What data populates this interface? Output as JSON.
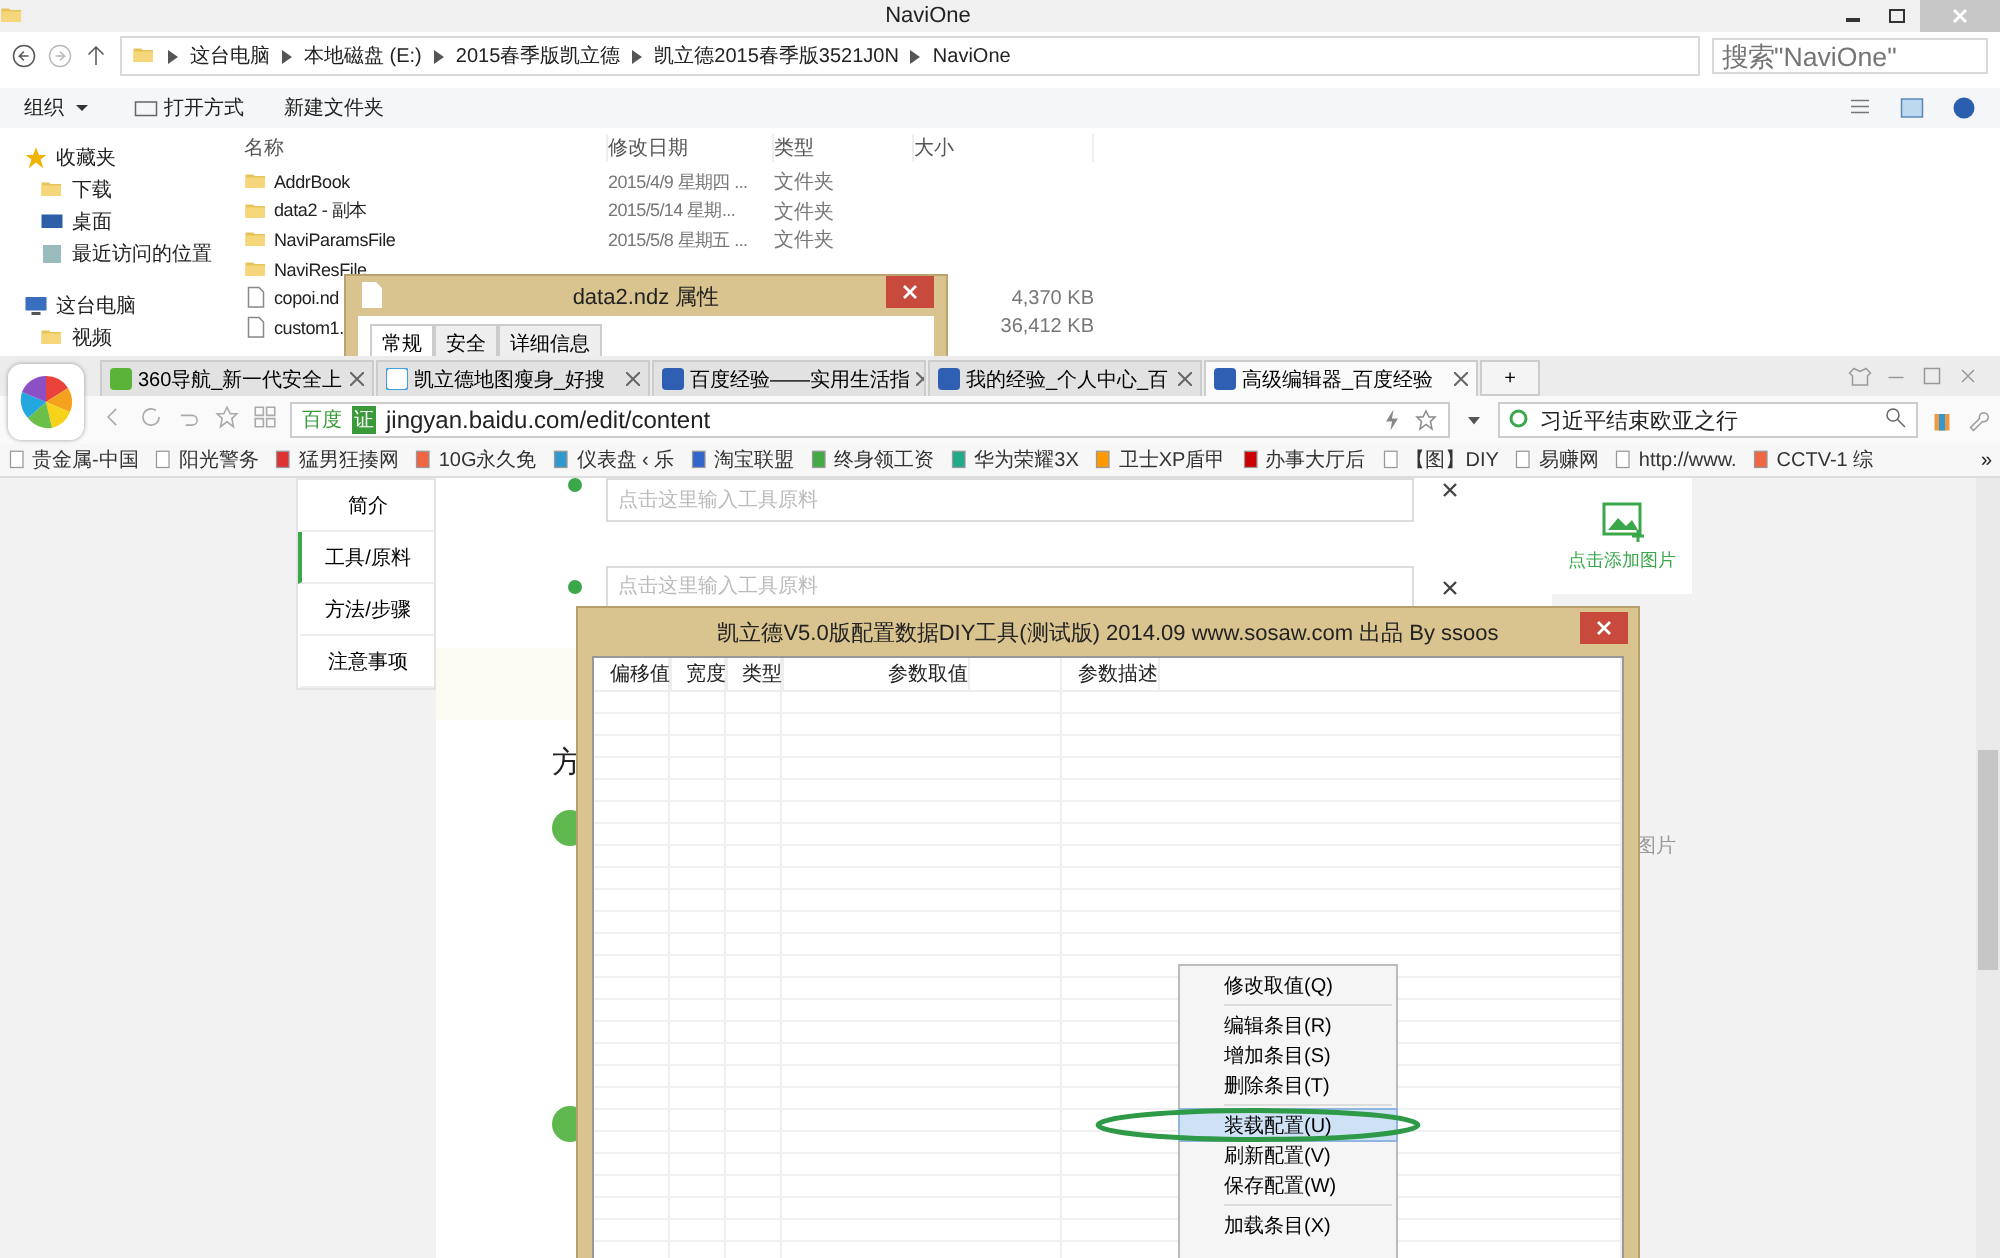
{
  "explorer": {
    "title": "NaviOne",
    "breadcrumb": [
      "这台电脑",
      "本地磁盘 (E:)",
      "2015春季版凯立德",
      "凯立德2015春季版3521J0N",
      "NaviOne"
    ],
    "search_placeholder": "搜索\"NaviOne\"",
    "toolbar": [
      {
        "label": "组织",
        "kind": "menu"
      },
      {
        "label": "打开方式",
        "kind": "open"
      },
      {
        "label": "新建文件夹",
        "kind": "plain"
      }
    ],
    "nav": [
      {
        "label": "收藏夹",
        "kind": "star"
      },
      {
        "label": "下载",
        "kind": "download"
      },
      {
        "label": "桌面",
        "kind": "desktop"
      },
      {
        "label": "最近访问的位置",
        "kind": "recent"
      },
      {
        "label": "这台电脑",
        "kind": "computer"
      },
      {
        "label": "视频",
        "kind": "video"
      }
    ],
    "columns": [
      "名称",
      "修改日期",
      "类型",
      "大小"
    ],
    "files": [
      {
        "name": "AddrBook",
        "kind": "folder",
        "date": "2015/4/9 星期四 ...",
        "type": "文件夹"
      },
      {
        "name": "data2 - 副本",
        "kind": "folder",
        "date": "2015/5/14 星期...",
        "type": "文件夹"
      },
      {
        "name": "NaviParamsFile",
        "kind": "folder",
        "date": "2015/5/8 星期五 ...",
        "type": "文件夹"
      },
      {
        "name": "NaviResFile",
        "kind": "folder"
      },
      {
        "name": "copoi.nd",
        "kind": "file",
        "size": "4,370 KB"
      },
      {
        "name": "custom1.",
        "kind": "file",
        "size": "36,412 KB"
      }
    ]
  },
  "properties": {
    "title": "data2.ndz 属性",
    "tabs": [
      {
        "label": "常规",
        "selected": true
      },
      {
        "label": "安全",
        "selected": false
      },
      {
        "label": "详细信息",
        "selected": false
      }
    ]
  },
  "browser": {
    "tabs": [
      {
        "label": "360导航_新一代安全上",
        "selected": false
      },
      {
        "label": "凯立德地图瘦身_好搜",
        "selected": false
      },
      {
        "label": "百度经验——实用生活指",
        "selected": false
      },
      {
        "label": "我的经验_个人中心_百",
        "selected": false
      },
      {
        "label": "高级编辑器_百度经验",
        "selected": true
      }
    ],
    "new_tab": "+",
    "site_badge": "百度",
    "cert_badge": "证",
    "url": "jingyan.baidu.com/edit/content",
    "search": "习近平结束欧亚之行",
    "bookmarks": [
      "贵金属-中国",
      "阳光警务",
      "猛男狂揍网",
      "10G永久免",
      "仪表盘 ‹ 乐",
      "淘宝联盟",
      "终身领工资",
      "华为荣耀3X",
      "卫士XP盾甲",
      "办事大厅后",
      "【图】DIY",
      "易赚网",
      "http://www.",
      "CCTV-1 综"
    ],
    "more": "»",
    "page": {
      "nav": [
        {
          "label": "简介",
          "selected": false
        },
        {
          "label": "工具/原料",
          "selected": true
        },
        {
          "label": "方法/步骤",
          "selected": false
        },
        {
          "label": "注意事项",
          "selected": false
        }
      ],
      "inputs": [
        {
          "placeholder": "点击这里输入工具原料"
        },
        {
          "placeholder": "点击这里输入工具原料"
        }
      ],
      "add_image": "点击添加图片",
      "heading": "方",
      "side_text": "图片"
    }
  },
  "dialog": {
    "title": "凯立德V5.0版配置数据DIY工具(测试版) 2014.09  www.sosaw.com 出品 By ssoos",
    "columns": [
      "偏移值",
      "宽度",
      "类型",
      "参数取值",
      "参数描述"
    ],
    "menu": [
      {
        "kind": "item",
        "label": "修改取值(Q)",
        "selected": false
      },
      {
        "kind": "separator"
      },
      {
        "kind": "item",
        "label": "编辑条目(R)",
        "selected": false
      },
      {
        "kind": "item",
        "label": "增加条目(S)",
        "selected": false
      },
      {
        "kind": "item",
        "label": "删除条目(T)",
        "selected": false
      },
      {
        "kind": "separator"
      },
      {
        "kind": "item",
        "label": "装载配置(U)",
        "selected": true
      },
      {
        "kind": "item",
        "label": "刷新配置(V)",
        "selected": false
      },
      {
        "kind": "item",
        "label": "保存配置(W)",
        "selected": false
      },
      {
        "kind": "separator"
      },
      {
        "kind": "item",
        "label": "加载条目(X)",
        "selected": false
      }
    ]
  }
}
